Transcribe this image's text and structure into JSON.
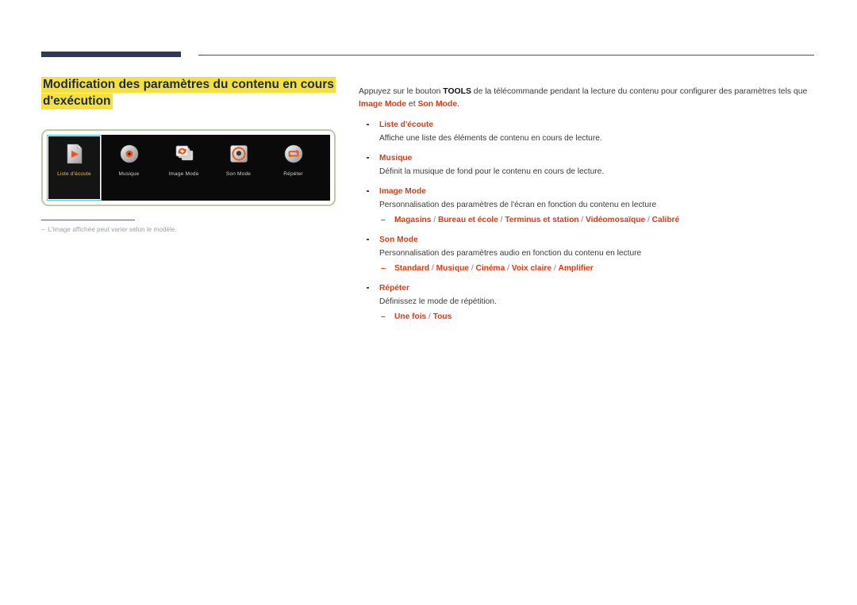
{
  "header": {
    "rule_thick": "",
    "rule_thin": ""
  },
  "title": {
    "line1": "Modification des paramètres du contenu en cours",
    "line2": "d'exécution",
    "highlight_color": "#f4e13f",
    "text_color": "#1f2a44"
  },
  "panel": {
    "frame_color": "#b8ccac",
    "background": "#0a0a0a",
    "selected_border_color": "#4ec8d6",
    "selected_label_color": "#e3c463",
    "items": [
      {
        "label": "Liste d'écoute",
        "icon": "playlist-document-icon",
        "selected": true
      },
      {
        "label": "Musique",
        "icon": "music-disc-icon",
        "selected": false
      },
      {
        "label": "Image Mode",
        "icon": "image-mode-cards-icon",
        "selected": false
      },
      {
        "label": "Son Mode",
        "icon": "sound-mode-speaker-icon",
        "selected": false
      },
      {
        "label": "Répéter",
        "icon": "repeat-loop-icon",
        "selected": false
      }
    ]
  },
  "footnote": {
    "dash": "–",
    "text": "L'image affichée peut varier selon le modèle."
  },
  "content": {
    "accent_color": "#e4380f",
    "intro": {
      "part1": "Appuyez sur le bouton ",
      "tools": "TOOLS",
      "part2": " de la télécommande pendant la lecture du contenu pour configurer des paramètres tels que ",
      "accent1": "Image Mode",
      "part3": " et ",
      "accent2": "Son Mode",
      "part4": "."
    },
    "bullets": [
      {
        "head": "Liste d'écoute",
        "desc": "Affiche une liste des éléments de contenu en cours de lecture.",
        "sub": null
      },
      {
        "head": "Musique",
        "desc": "Définit la musique de fond pour le contenu en cours de lecture.",
        "sub": null
      },
      {
        "head": "Image Mode",
        "desc": "Personnalisation des paramètres de l'écran en fonction du contenu en lecture",
        "sub": "Magasins / Bureau et école / Terminus et station / Vidéomosaïque / Calibré",
        "sub_options": [
          "Magasins",
          "Bureau et école",
          "Terminus et station",
          "Vidéomosaïque",
          "Calibré"
        ]
      },
      {
        "head": "Son Mode",
        "desc": "Personnalisation des paramètres audio en fonction du contenu en lecture",
        "sub": "Standard / Musique / Cinéma / Voix claire / Amplifier",
        "sub_options": [
          "Standard",
          "Musique",
          "Cinéma",
          "Voix claire",
          "Amplifier"
        ]
      },
      {
        "head": "Répéter",
        "desc": "Définissez le mode de répétition.",
        "sub": "Une fois / Tous",
        "sub_options": [
          "Une fois",
          "Tous"
        ]
      }
    ],
    "sub_dash": "–"
  }
}
